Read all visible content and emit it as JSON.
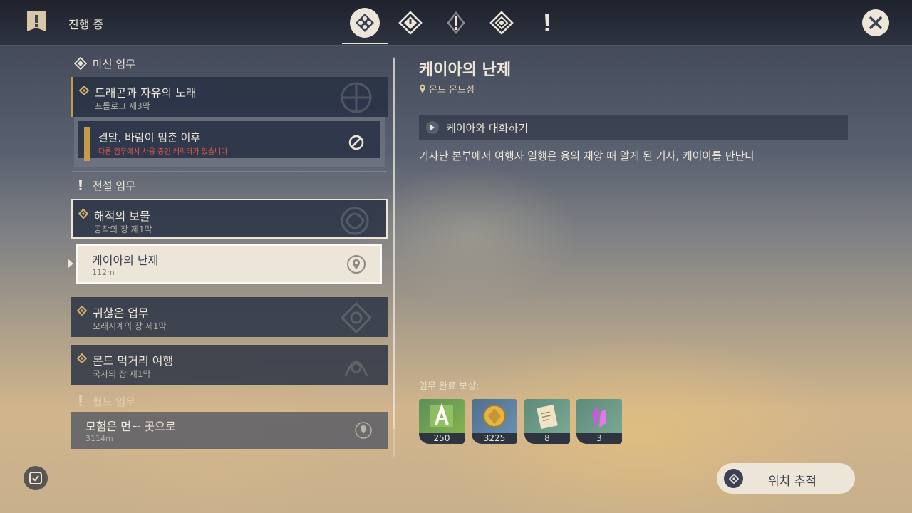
{
  "header": {
    "title": "진행 중"
  },
  "tabs": [
    {
      "name": "all-quests",
      "active": true
    },
    {
      "name": "archon-quests",
      "active": false
    },
    {
      "name": "story-quests",
      "active": false
    },
    {
      "name": "commission-quests",
      "active": false
    },
    {
      "name": "world-quests",
      "active": false
    }
  ],
  "sections": {
    "archon": {
      "label": "마신 임무"
    },
    "legend": {
      "label": "전설 임무"
    },
    "world": {
      "label": "월드 임무"
    }
  },
  "quests": {
    "archon_main": {
      "title": "드래곤과 자유의 노래",
      "subtitle": "프롤로그 제3막"
    },
    "archon_step": {
      "title": "결말, 바람이 멈춘 이후",
      "warning": "다른 임무에서 사용 중인 캐릭터가 있습니다"
    },
    "legend_1": {
      "title": "해적의 보물",
      "subtitle": "공작의 장 제1막"
    },
    "legend_1_step": {
      "title": "케이아의 난제",
      "distance": "112m"
    },
    "legend_2": {
      "title": "귀찮은 업무",
      "subtitle": "모래시계의 장 제1막"
    },
    "legend_3": {
      "title": "몬드 먹거리 여행",
      "subtitle": "국자의 장 제1막"
    },
    "world_1": {
      "title": "모험은 먼~ 곳으로",
      "distance": "3114m"
    }
  },
  "detail": {
    "title": "케이아의 난제",
    "location": "몬드 몬드성",
    "objective": "케이아와 대화하기",
    "description": "기사단 본부에서 여행자 일행은 용의 재앙 때 알게 된 기사, 케이아를 만난다"
  },
  "rewards": {
    "label": "임무 완료 보상:",
    "items": [
      {
        "icon": "adventure-exp-icon",
        "count": "250"
      },
      {
        "icon": "mora-icon",
        "count": "3225"
      },
      {
        "icon": "heros-wit-icon",
        "count": "8"
      },
      {
        "icon": "crystal-icon",
        "count": "3"
      }
    ]
  },
  "actions": {
    "track_label": "위치 추적"
  },
  "colors": {
    "gold": "#c59b49",
    "cream": "#ece5d8",
    "dark_text": "#3b4255",
    "warning": "#e45a4a"
  }
}
